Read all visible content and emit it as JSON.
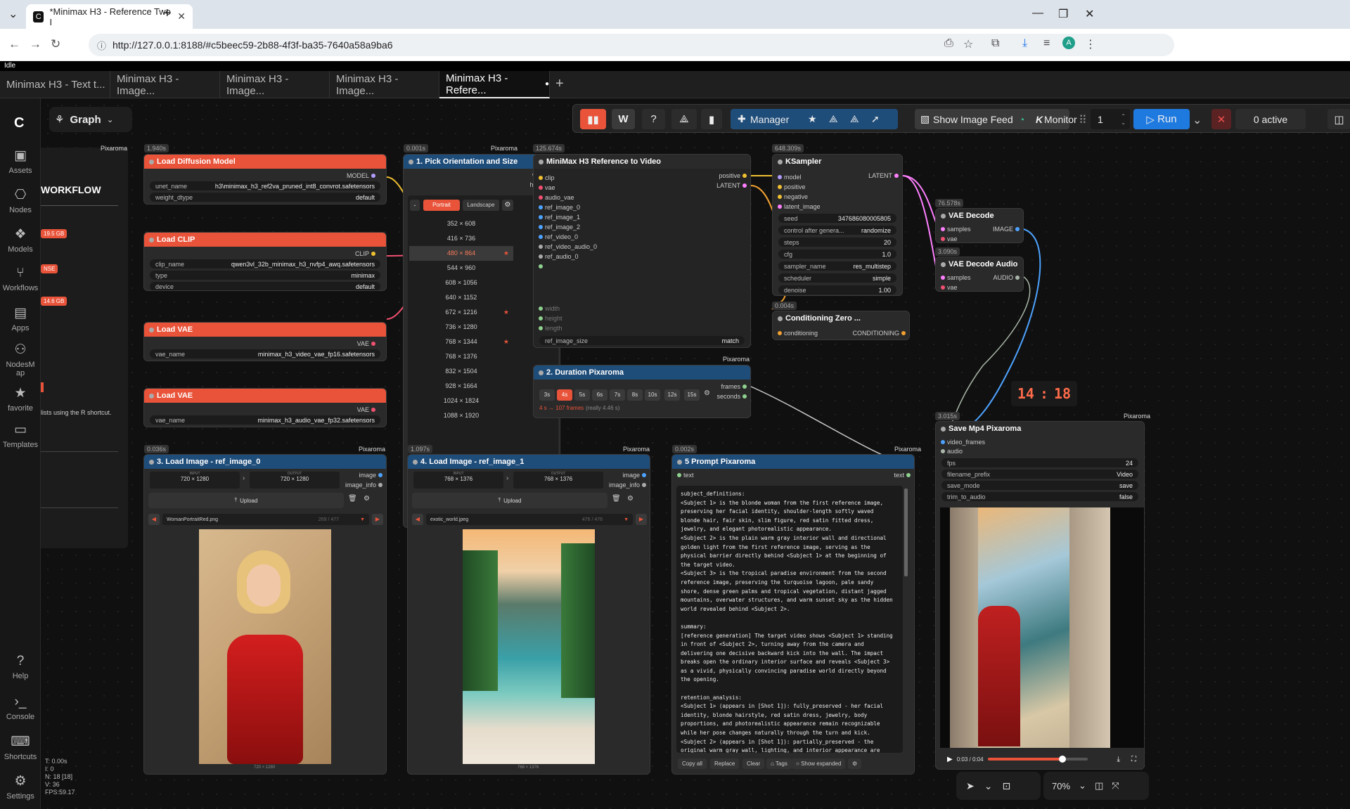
{
  "browser": {
    "tab_title": "*Minimax H3 - Reference Two I",
    "url": "http://127.0.0.1:8188/#c5beec59-2b88-4f3f-ba35-7640a58a9ba6",
    "profile_initial": "A"
  },
  "status": {
    "idle": "Idle"
  },
  "workflow_tabs": [
    {
      "label": "Minimax H3 - Text t..."
    },
    {
      "label": "Minimax H3 - Image..."
    },
    {
      "label": "Minimax H3 - Image..."
    },
    {
      "label": "Minimax H3 - Image..."
    },
    {
      "label": "Minimax H3 - Refere..."
    }
  ],
  "sidebar": {
    "items": [
      {
        "label": "Assets"
      },
      {
        "label": "Nodes"
      },
      {
        "label": "Models"
      },
      {
        "label": "Workflows"
      },
      {
        "label": "Apps"
      },
      {
        "label": "NodesMap"
      },
      {
        "label": "favorite"
      },
      {
        "label": "Templates"
      }
    ],
    "bottom": [
      {
        "label": "Help"
      },
      {
        "label": "Console"
      },
      {
        "label": "Shortcuts"
      },
      {
        "label": "Settings"
      }
    ],
    "stats": [
      "T: 0.00s",
      "I: 0",
      "N: 18 [18]",
      "V: 36",
      "FPS:59.17"
    ]
  },
  "graph_menu": {
    "label": "Graph"
  },
  "panel": {
    "title": "WORKFLOW",
    "badges": [
      "19.5 GB",
      "NSE",
      "14.6 GB"
    ],
    "hint": "lists using the R shortcut."
  },
  "toolbar": {
    "manager": "Manager",
    "show_feed": "Show Image Feed",
    "monitor": "Monitor",
    "queue_count": "1",
    "run": "Run",
    "active": "0 active"
  },
  "nodes": {
    "load_diffusion": {
      "time": "1.940s",
      "title": "Load Diffusion Model",
      "output": "MODEL",
      "brand": "Pixaroma",
      "w1_label": "unet_name",
      "w1_value": "h3\\minimax_h3_ref2va_pruned_int8_convrot.safetensors",
      "w2_label": "weight_dtype",
      "w2_value": "default"
    },
    "load_clip": {
      "title": "Load CLIP",
      "output": "CLIP",
      "w1_label": "clip_name",
      "w1_value": "qwen3vl_32b_minimax_h3_nvfp4_awq.safetensors",
      "w2_label": "type",
      "w2_value": "minimax",
      "w3_label": "device",
      "w3_value": "default"
    },
    "load_vae1": {
      "title": "Load VAE",
      "output": "VAE",
      "w1_label": "vae_name",
      "w1_value": "minimax_h3_video_vae_fp16.safetensors"
    },
    "load_vae2": {
      "title": "Load VAE",
      "output": "VAE",
      "w1_label": "vae_name",
      "w1_value": "minimax_h3_audio_vae_fp32.safetensors"
    },
    "orientation": {
      "time": "0.001s",
      "title": "1. Pick Orientation and Size",
      "brand": "Pixaroma",
      "out1": "width",
      "out2": "height",
      "portrait": "Portrait",
      "landscape": "Landscape",
      "sizes": [
        "352 × 608",
        "416 × 736",
        "480 × 864",
        "544 × 960",
        "608 × 1056",
        "640 × 1152",
        "672 × 1216",
        "736 × 1280",
        "768 × 1344",
        "768 × 1376",
        "832 × 1504",
        "928 × 1664",
        "1024 × 1824",
        "1088 × 1920"
      ]
    },
    "minimax_ref": {
      "time": "125.674s",
      "title": "MiniMax H3 Reference to Video",
      "inputs": [
        "clip",
        "vae",
        "audio_vae",
        "ref_image_0",
        "ref_image_1",
        "ref_image_2",
        "ref_video_0",
        "ref_video_audio_0",
        "ref_audio_0"
      ],
      "outputs": [
        "positive",
        "LATENT"
      ],
      "widgets": [
        "width",
        "height",
        "length"
      ],
      "ref_label": "ref_image_size",
      "ref_value": "match"
    },
    "ksampler": {
      "time": "648.309s",
      "title": "KSampler",
      "inputs": [
        "model",
        "positive",
        "negative",
        "latent_image"
      ],
      "output": "LATENT",
      "w": [
        {
          "l": "seed",
          "v": "347686080005805"
        },
        {
          "l": "control after genera...",
          "v": "randomize"
        },
        {
          "l": "steps",
          "v": "20"
        },
        {
          "l": "cfg",
          "v": "1.0"
        },
        {
          "l": "sampler_name",
          "v": "res_multistep"
        },
        {
          "l": "scheduler",
          "v": "simple"
        },
        {
          "l": "denoise",
          "v": "1.00"
        }
      ]
    },
    "vae_decode": {
      "time": "76.578s",
      "title": "VAE Decode",
      "in1": "samples",
      "in2": "vae",
      "output": "IMAGE"
    },
    "vae_decode_audio": {
      "time": "3.090s",
      "title": "VAE Decode Audio",
      "in1": "samples",
      "in2": "vae",
      "output": "AUDIO"
    },
    "cond_zero": {
      "time": "0.004s",
      "title": "Conditioning Zero ...",
      "in1": "conditioning",
      "output": "CONDITIONING"
    },
    "duration": {
      "title": "2. Duration Pixaroma",
      "brand": "Pixaroma",
      "buttons": [
        "3s",
        "4s",
        "5s",
        "6s",
        "7s",
        "8s",
        "10s",
        "12s",
        "15s"
      ],
      "info": "4 s → 107 frames",
      "info2": "(really 4.46 s)",
      "out1": "frames",
      "out2": "seconds"
    },
    "save_mp4": {
      "time": "3.015s",
      "title": "Save Mp4 Pixaroma",
      "brand": "Pixaroma",
      "in1": "video_frames",
      "in2": "audio",
      "w": [
        {
          "l": "fps",
          "v": "24"
        },
        {
          "l": "filename_prefix",
          "v": "Video"
        },
        {
          "l": "save_mode",
          "v": "save"
        },
        {
          "l": "trim_to_audio",
          "v": "false"
        }
      ],
      "time_display": "0:03 / 0:04",
      "progress": 0.75
    },
    "load_img0": {
      "time": "0.036s",
      "title": "3. Load Image - ref_image_0",
      "brand": "Pixaroma",
      "input_label": "INPUT",
      "input": "720 × 1280",
      "output_label": "OUTPUT",
      "output": "720 × 1280",
      "out1": "image",
      "out2": "image_info",
      "upload": "Upload",
      "file": "WomanPortraitRed.png",
      "counter": "269 / 477",
      "caption": "720 × 1280"
    },
    "load_img1": {
      "time": "1.097s",
      "title": "4. Load Image - ref_image_1",
      "brand": "Pixaroma",
      "input_label": "INPUT",
      "input": "768 × 1376",
      "output_label": "OUTPUT",
      "output": "768 × 1376",
      "out1": "image",
      "out2": "image_info",
      "upload": "Upload",
      "file": "exotic_world.jpeg",
      "counter": "476 / 476",
      "caption": "768 × 1376"
    },
    "prompt": {
      "time": "0.002s",
      "title": "5 Prompt Pixaroma",
      "brand": "Pixaroma",
      "in1": "text",
      "out1": "text",
      "lines": [
        "subject_definitions:",
        "<Subject 1> is the blonde woman from the first reference image,",
        "preserving her facial identity, shoulder-length softly waved",
        "blonde hair, fair skin, slim figure, red satin fitted dress,",
        "jewelry, and elegant photorealistic appearance.",
        "<Subject 2> is the plain warm gray interior wall and directional",
        "golden light from the first reference image, serving as the",
        "physical barrier directly behind <Subject 1> at the beginning of",
        "the target video.",
        "<Subject 3> is the tropical paradise environment from the second",
        "reference image, preserving the turquoise lagoon, pale sandy",
        "shore, dense green palms and tropical vegetation, distant jagged",
        "mountains, overwater structures, and warm sunset sky as the hidden",
        "world revealed behind <Subject 2>.",
        "",
        "summary:",
        "[reference generation] The target video shows <Subject 1> standing",
        "in front of <Subject 2>, turning away from the camera and",
        "delivering one decisive backward kick into the wall. The impact",
        "breaks open the ordinary interior surface and reveals <Subject 3>",
        "as a vivid, physically convincing paradise world directly beyond",
        "the opening.",
        "",
        "retention_analysis:",
        "<Subject 1> (appears in [Shot 1]): fully_preserved - her facial",
        "identity, blonde hairstyle, red satin dress, jewelry, body",
        "proportions, and photorealistic appearance remain recognizable",
        "while her pose changes naturally through the turn and kick.",
        "<Subject 2> (appears in [Shot 1]): partially_preserved - the",
        "original warm gray wall, lighting, and interior appearance are"
      ],
      "buttons": [
        "Copy all",
        "Replace",
        "Clear",
        "Tags",
        "Show expanded"
      ]
    }
  },
  "clock": {
    "hours": "14",
    "minutes": "18"
  },
  "bottom_controls": {
    "zoom": "70%"
  },
  "colors": {
    "red_header": "#e8533a",
    "blue_header": "#1f4d7a",
    "run": "#1f7ae0",
    "accent": "#f57a5a"
  }
}
